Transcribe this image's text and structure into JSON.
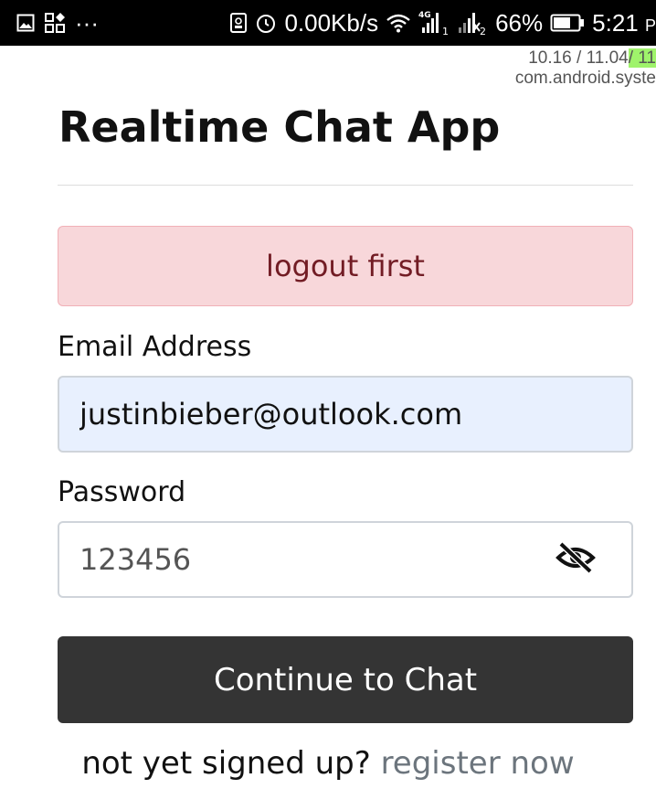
{
  "status_bar": {
    "left_icons": [
      "image-icon",
      "apps-icon",
      "more-icon"
    ],
    "more_text": "···",
    "data_speed": "0.00Kb/s",
    "network_type": "4G",
    "sim1": "1",
    "sim2": "2",
    "battery": "66%",
    "time": "5:21",
    "time_suffix": "P"
  },
  "overlay": {
    "line1_a": "10.16 / 11.04",
    "line1_b": "/ 11",
    "line2": "com.android.syste"
  },
  "app": {
    "title": "Realtime Chat App"
  },
  "alert": {
    "message": "logout first"
  },
  "form": {
    "email_label": "Email Address",
    "email_value": "justinbieber@outlook.com",
    "password_label": "Password",
    "password_value": "123456",
    "submit_label": "Continue to Chat"
  },
  "footer": {
    "prompt": "not yet signed up?",
    "register_link": "register now"
  },
  "colors": {
    "alert_bg": "#f8d7da",
    "alert_text": "#721c24",
    "email_bg": "#e8f0fe",
    "button_bg": "#343434",
    "link": "#6c757d"
  }
}
